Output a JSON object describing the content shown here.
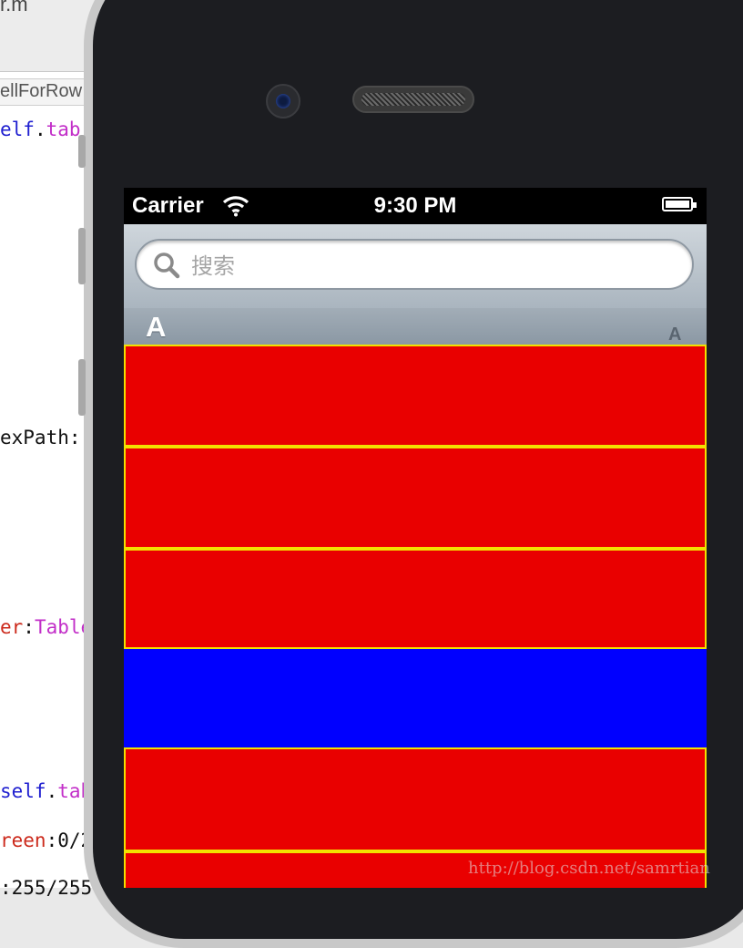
{
  "editor": {
    "title_fragment": "r.m",
    "tab_label": "ellForRow",
    "code_lines": [
      {
        "parts": [
          {
            "text": "elf",
            "cls": "kw-blue"
          },
          {
            "text": ".",
            "cls": "kw-black"
          },
          {
            "text": "tab",
            "cls": "kw-pink"
          }
        ]
      },
      {
        "parts": [
          {
            "text": "exPath:",
            "cls": "kw-black"
          }
        ]
      },
      {
        "parts": [
          {
            "text": "er",
            "cls": "kw-red"
          },
          {
            "text": ":",
            "cls": "kw-black"
          },
          {
            "text": "Table",
            "cls": "kw-pink"
          }
        ]
      },
      {
        "parts": [
          {
            "text": "self",
            "cls": "kw-blue"
          },
          {
            "text": ".",
            "cls": "kw-black"
          },
          {
            "text": "tab",
            "cls": "kw-pink"
          }
        ]
      },
      {
        "parts": [
          {
            "text": "reen",
            "cls": "kw-red"
          },
          {
            "text": ":0/2",
            "cls": "kw-black"
          }
        ]
      },
      {
        "parts": [
          {
            "text": ":255/255",
            "cls": "kw-black"
          }
        ]
      }
    ]
  },
  "statusbar": {
    "carrier": "Carrier",
    "time": "9:30 PM"
  },
  "search": {
    "placeholder": "搜索"
  },
  "section": {
    "header_letter": "A",
    "index_letter": "A"
  },
  "table": {
    "cells": [
      {
        "color": "red"
      },
      {
        "color": "red"
      },
      {
        "color": "red"
      },
      {
        "color": "blue"
      },
      {
        "color": "red"
      },
      {
        "color": "red"
      }
    ]
  },
  "watermark": "http://blog.csdn.net/samrtian"
}
